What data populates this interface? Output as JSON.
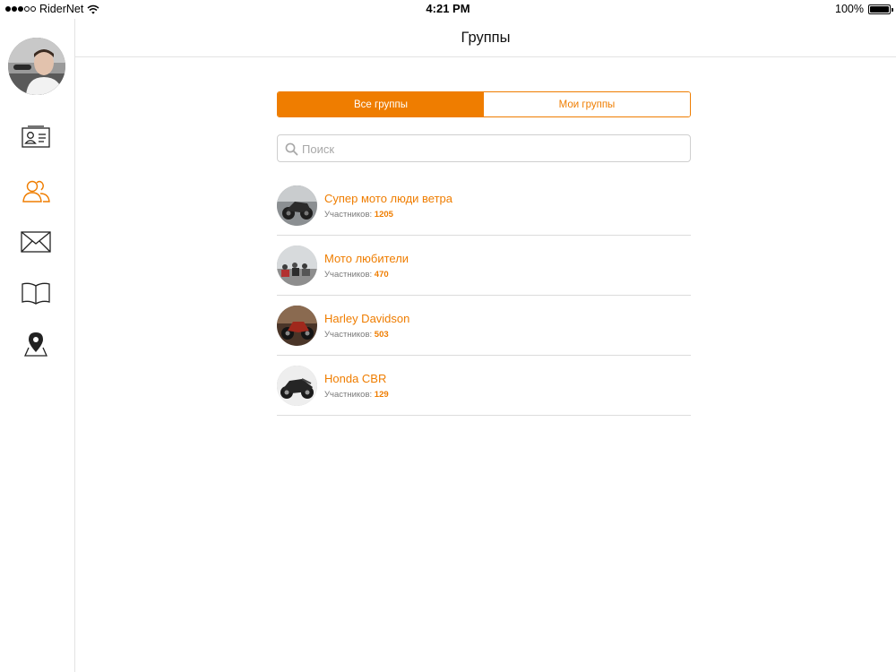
{
  "status_bar": {
    "carrier": "RiderNet",
    "time": "4:21 PM",
    "battery": "100%"
  },
  "sidebar": {
    "items": [
      {
        "icon": "contact-card-icon",
        "active": false
      },
      {
        "icon": "group-people-icon",
        "active": true
      },
      {
        "icon": "mail-icon",
        "active": false
      },
      {
        "icon": "book-icon",
        "active": false
      },
      {
        "icon": "map-pin-icon",
        "active": false
      }
    ]
  },
  "header": {
    "title": "Группы"
  },
  "tabs": {
    "all_label": "Все группы",
    "mine_label": "Мои группы",
    "selected": "all"
  },
  "search": {
    "placeholder": "Поиск",
    "value": ""
  },
  "groups": [
    {
      "name": "Супер мото люди ветра",
      "members_label": "Участников:",
      "members": "1205"
    },
    {
      "name": "Мото любители",
      "members_label": "Участников:",
      "members": "470"
    },
    {
      "name": "Harley Davidson",
      "members_label": "Участников:",
      "members": "503"
    },
    {
      "name": "Honda CBR",
      "members_label": "Участников:",
      "members": "129"
    }
  ],
  "colors": {
    "accent": "#ef7d00",
    "icon_inactive": "#222222",
    "divider": "#dcdcdc"
  }
}
